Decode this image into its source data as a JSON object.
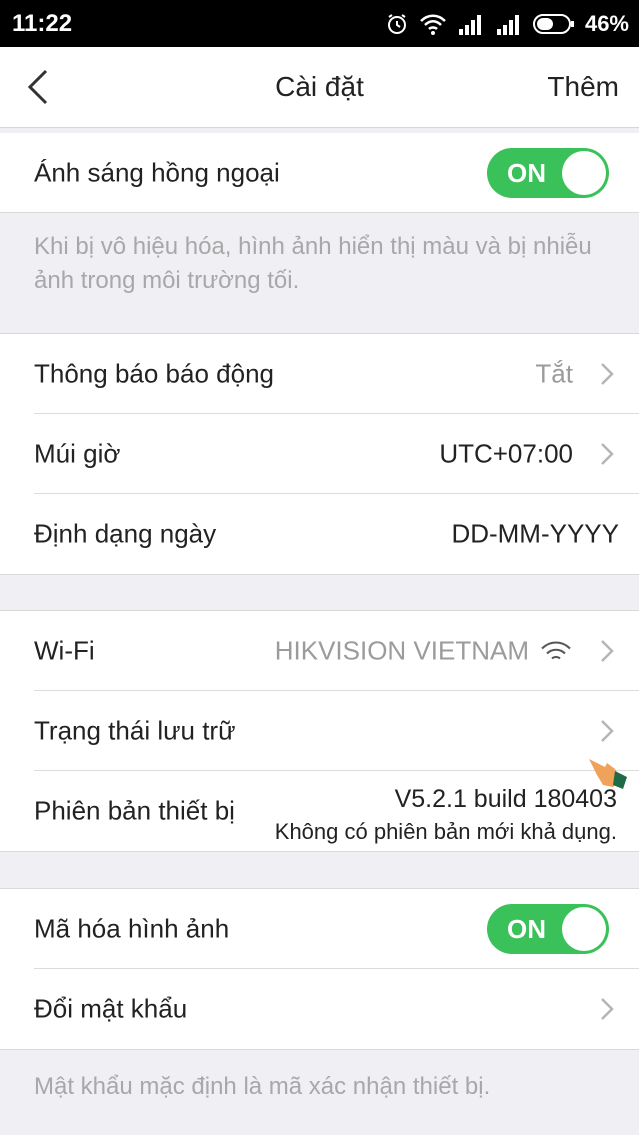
{
  "status_bar": {
    "time": "11:22",
    "battery": "46%"
  },
  "header": {
    "back_icon": "chevron-left-icon",
    "title": "Cài đặt",
    "more_label": "Thêm"
  },
  "infrared": {
    "label": "Ánh sáng hồng ngoại",
    "toggle": "ON",
    "note": "Khi bị vô hiệu hóa, hình ảnh hiển thị màu và bị nhiễu ảnh trong môi trường tối."
  },
  "alarm": {
    "label": "Thông báo báo động",
    "value": "Tắt"
  },
  "timezone": {
    "label": "Múi giờ",
    "value": "UTC+07:00"
  },
  "date_format": {
    "label": "Định dạng ngày",
    "value": "DD-MM-YYYY"
  },
  "wifi": {
    "label": "Wi-Fi",
    "value": "HIKVISION VIETNAM"
  },
  "storage": {
    "label": "Trạng thái lưu trữ"
  },
  "device_version": {
    "label": "Phiên bản thiết bị",
    "version": "V5.2.1 build 180403",
    "status": "Không có phiên bản mới khả dụng."
  },
  "image_encryption": {
    "label": "Mã hóa hình ảnh",
    "toggle": "ON"
  },
  "change_password": {
    "label": "Đổi mật khẩu",
    "note": "Mật khẩu mặc định là mã xác nhận thiết bị."
  },
  "colors": {
    "toggle_on": "#3bc15a",
    "background": "#efeff4"
  }
}
